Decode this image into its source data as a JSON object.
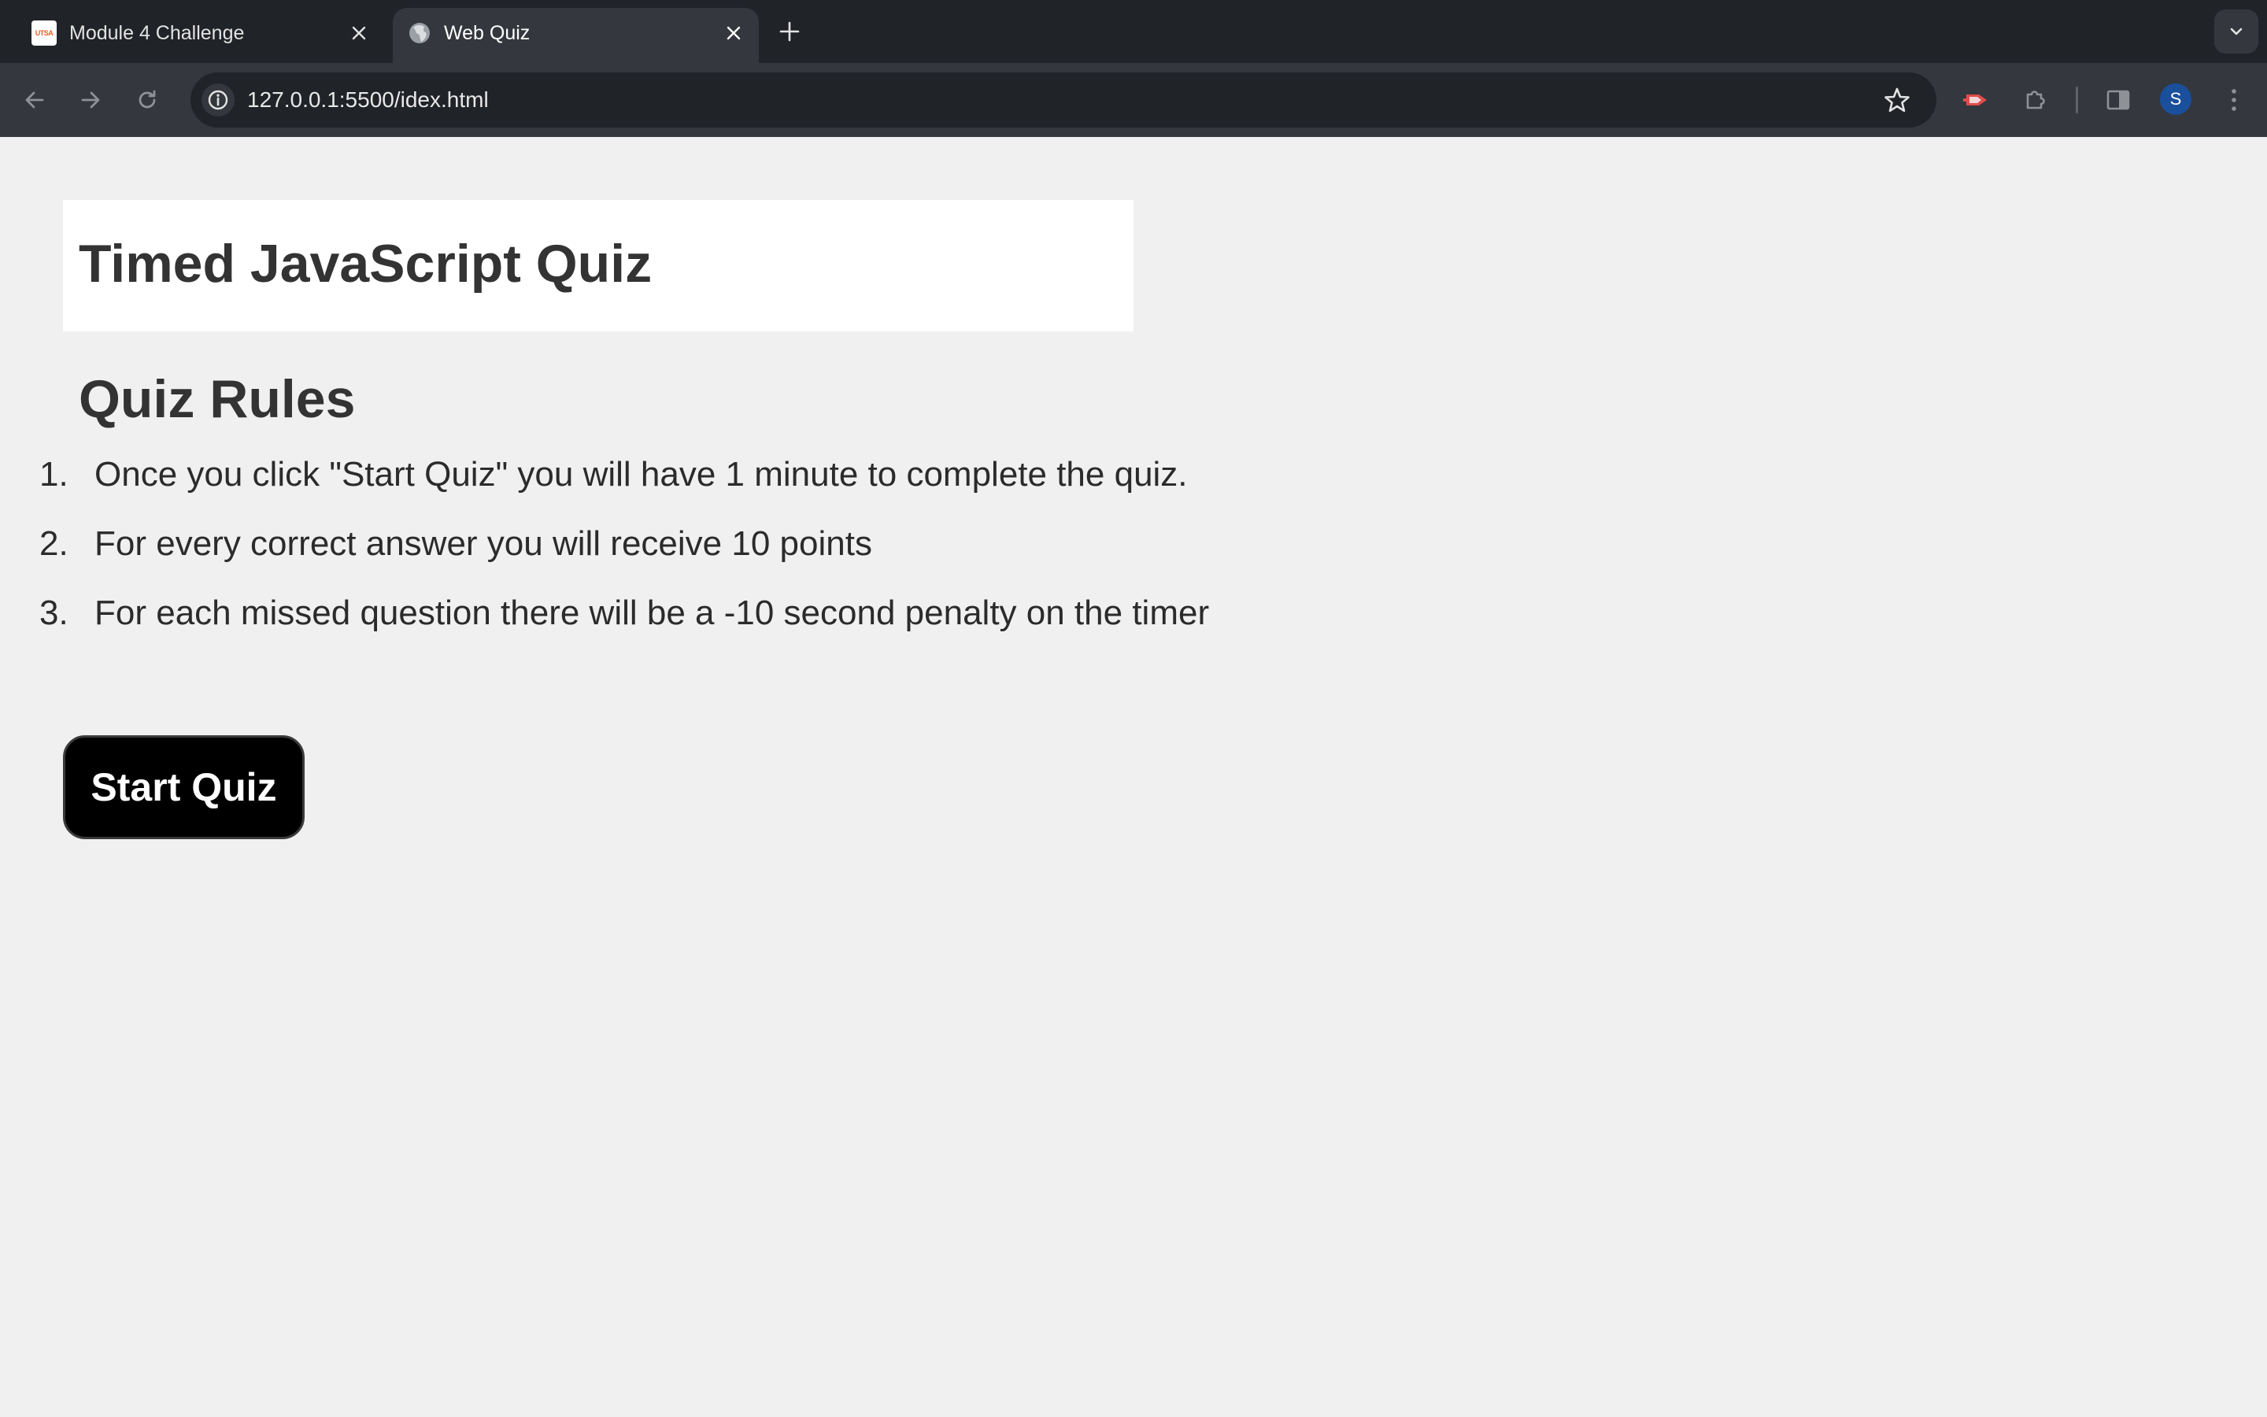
{
  "browser": {
    "tabs": [
      {
        "title": "Module 4 Challenge",
        "favicon": "utsa-icon",
        "favicon_text": "UTSA",
        "active": false
      },
      {
        "title": "Web Quiz",
        "favicon": "globe-icon",
        "active": true
      }
    ],
    "url": "127.0.0.1:5500/idex.html",
    "profile_initial": "S",
    "colors": {
      "tabstrip_bg": "#202328",
      "toolbar_bg": "#34373d",
      "profile_avatar": "#1a4f9c",
      "page_bg": "#f0f0f0"
    }
  },
  "page": {
    "title": "Timed JavaScript Quiz",
    "rules_heading": "Quiz Rules",
    "rules": [
      {
        "num": "1.",
        "text": "Once you click \"Start Quiz\" you will have 1 minute to complete the quiz."
      },
      {
        "num": "2.",
        "text": "For every correct answer you will receive 10 points"
      },
      {
        "num": "3.",
        "text": "For each missed question there will be a -10 second penalty on the timer"
      }
    ],
    "start_button_label": "Start Quiz"
  }
}
